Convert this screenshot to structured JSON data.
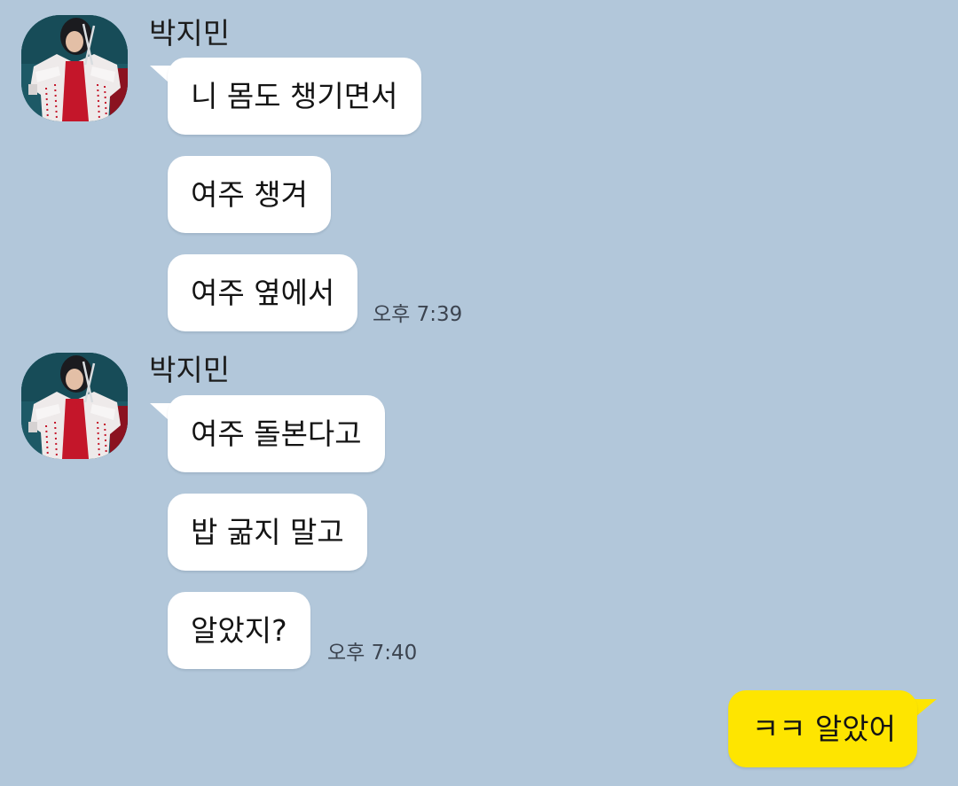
{
  "groups": [
    {
      "sender": "박지민",
      "messages": [
        "니 몸도 챙기면서",
        "여주 챙겨",
        "여주 옆에서"
      ],
      "time": "오후 7:39"
    },
    {
      "sender": "박지민",
      "messages": [
        "여주 돌본다고",
        "밥 굶지 말고",
        "알았지?"
      ],
      "time": "오후 7:40"
    }
  ],
  "my_message": "ㅋㅋ 알았어",
  "colors": {
    "background": "#b2c7da",
    "incoming_bubble": "#ffffff",
    "outgoing_bubble": "#fee500"
  },
  "avatar_icon": "profile-photo"
}
